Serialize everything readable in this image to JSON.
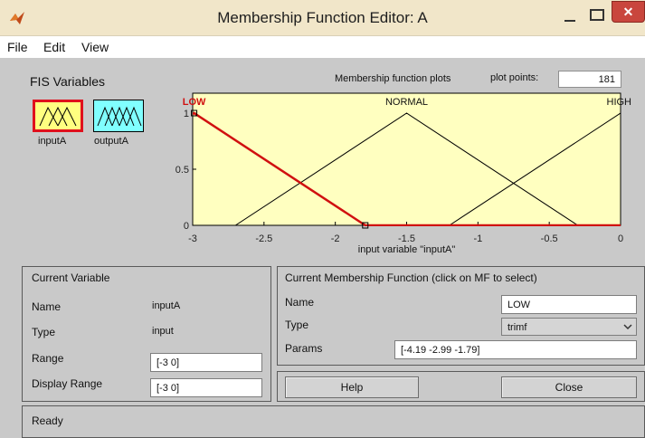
{
  "window": {
    "title": "Membership Function Editor: A",
    "close_glyph": "✕"
  },
  "menu": {
    "file": "File",
    "edit": "Edit",
    "view": "View"
  },
  "fis_variables": {
    "title": "FIS Variables",
    "items": [
      {
        "label": "inputA",
        "selected": true,
        "fill": "#ffff80",
        "border": "#e0101c"
      },
      {
        "label": "outputA",
        "selected": false,
        "fill": "#80ffff",
        "border": "#000000"
      }
    ]
  },
  "plot_header": {
    "title": "Membership function plots",
    "points_label": "plot points:",
    "points_value": "181"
  },
  "chart_data": {
    "type": "line",
    "xlim": [
      -3,
      0
    ],
    "ylim": [
      0,
      1
    ],
    "xticks": [
      "-3",
      "-2.5",
      "-2",
      "-1.5",
      "-1",
      "-0.5",
      "0"
    ],
    "yticks": [
      "0",
      "0.5",
      "1"
    ],
    "xlabel": "input variable \"inputA\"",
    "background": "#ffffc0",
    "series": [
      {
        "name": "LOW",
        "params": [
          -4.19,
          -2.99,
          -1.79
        ],
        "color": "#d01010",
        "selected": true
      },
      {
        "name": "NORMAL",
        "params": [
          -2.7,
          -1.5,
          -0.3
        ],
        "color": "#000000",
        "selected": false
      },
      {
        "name": "HIGH",
        "params": [
          -1.2,
          0,
          1.2
        ],
        "color": "#000000",
        "selected": false
      }
    ]
  },
  "current_variable": {
    "title": "Current Variable",
    "name_label": "Name",
    "name_value": "inputA",
    "type_label": "Type",
    "type_value": "input",
    "range_label": "Range",
    "range_value": "[-3 0]",
    "display_range_label": "Display Range",
    "display_range_value": "[-3 0]"
  },
  "current_mf": {
    "title": "Current Membership Function (click on MF to select)",
    "name_label": "Name",
    "name_value": "LOW",
    "type_label": "Type",
    "type_value": "trimf",
    "params_label": "Params",
    "params_value": "[-4.19 -2.99 -1.79]"
  },
  "buttons": {
    "help": "Help",
    "close": "Close"
  },
  "status": {
    "text": "Ready"
  }
}
